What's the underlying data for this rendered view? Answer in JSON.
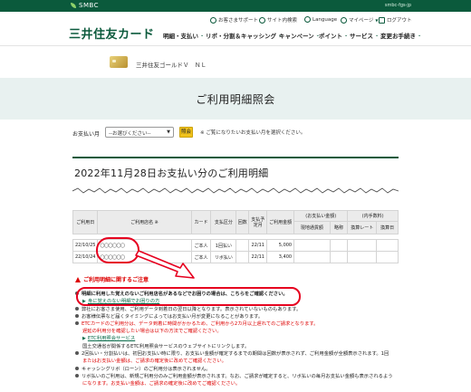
{
  "topbar": {
    "brand": "SMBC",
    "ext_link": "smbc-fgs-jp"
  },
  "header": {
    "logo": "三井住友カード",
    "util": {
      "support": "お客さまサポート",
      "sitemap": "サイト内検索",
      "language": "Language",
      "mypage": "マイページ",
      "logout": "ログアウト"
    },
    "nav": [
      "明細・支払い",
      "リボ・分割＆キャッシング",
      "キャンペーン",
      "ポイント",
      "サービス",
      "変更お手続き"
    ]
  },
  "card": {
    "name": "三井住友ゴールドＶ　ＮＬ"
  },
  "page_title": "ご利用明細照会",
  "month_picker": {
    "label": "お支払い月",
    "selected": "--お選びください--",
    "button": "照会",
    "note": "※ ご覧になりたいお支払い月を選択ください。"
  },
  "statement": {
    "title": "2022年11月28日お支払い分のご利用明細",
    "headers": {
      "date": "ご利用日",
      "store": "ご利用店名 ※",
      "card": "カード",
      "pay_type": "支払区分",
      "installments": "回数",
      "pay_month": "支払予定月",
      "amount": "ご利用金額",
      "pay_amount_group": "(お支払い金額)",
      "local_group": "(内手数料)",
      "local_currency": "現地通貨額",
      "abbrev": "略称",
      "rate": "換算レート",
      "conv_date": "換算日"
    },
    "rows": [
      {
        "date": "22/10/25",
        "store": "〇〇〇〇〇〇",
        "card": "ご本人",
        "pay_type": "1回払い",
        "installments": "",
        "pay_month": "22/11",
        "amount": "5,000"
      },
      {
        "date": "22/10/24",
        "store": "〇〇〇〇〇〇",
        "card": "ご本人",
        "pay_type": "リボ払い",
        "installments": "",
        "pay_month": "22/11",
        "amount": "3,400"
      }
    ]
  },
  "notes": {
    "title": "ご利用明細に関するご注意",
    "lines": [
      {
        "text": "明細に利用した覚えのないご利用店名があるなどでお困りの場合は、こちらをご確認ください。",
        "style": "bold"
      },
      {
        "text": "身に覚えのない明細でお困りの方",
        "style": "link"
      },
      {
        "text": "弊社にお客さま使用、ご利用データ到着日の翌日以降となります。表示されていないものもあります。",
        "style": "normal"
      },
      {
        "text": "お客様伝票など届くタイミングによってはお支払い月が変更になることがあります。",
        "style": "normal"
      },
      {
        "text": "ETCカードのご利用分は、データ到着に時間がかかるため、ご利用から2カ月以上遅れてのご請求となります。",
        "style": "red"
      },
      {
        "text": "遅延の利用分を確認したい場合は以下の方法でご確認ください。",
        "style": "red-indent"
      },
      {
        "text": "ETC利用照会サービス",
        "style": "link"
      },
      {
        "text": "国土交通省が関係するETC利用照会サービスのウェブサイトにリンクします。",
        "style": "indent"
      },
      {
        "text": "2回払い・分割払いは、初回お支払い時に限り、お支払い金額が確定するまでの期間は回数が表示されず、ご利用金額が全額表示されます。1回",
        "style": "mixed"
      },
      {
        "text": "またはお支払い金額は、ご請求の確定後に改めてご確認ください。",
        "style": "red-indent"
      },
      {
        "text": "キャッシングリボ（ローン）のご利用分は表示されません。",
        "style": "normal"
      },
      {
        "text": "リボ払いのご利用は、新規ご利用分のみご利用金額が表示されます。なお、ご請求が確定すると、リボ払いの毎月お支払い金額も表示されるよう",
        "style": "normal"
      },
      {
        "text": "になります。お支払い金額は、ご請求の確定後に改めてご確認ください。",
        "style": "red-indent"
      }
    ]
  },
  "colors": {
    "brand_green": "#0b5a3c",
    "accent_yellow": "#f1c21a",
    "highlight_red": "#e6001f",
    "hero_bg": "#e8f1f0"
  }
}
